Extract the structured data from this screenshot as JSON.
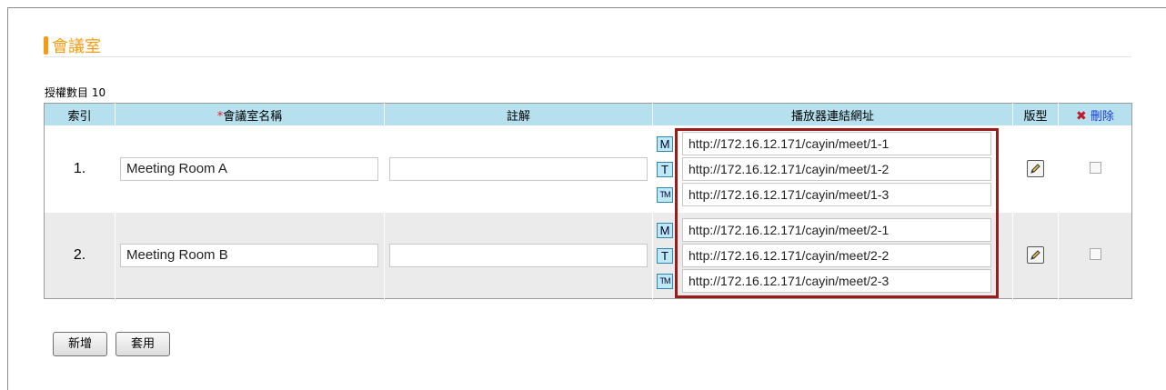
{
  "section": {
    "title": "會議室"
  },
  "license": {
    "label": "授權數目 10"
  },
  "table": {
    "headers": {
      "index": "索引",
      "required_mark": "*",
      "name": "會議室名稱",
      "note": "註解",
      "player_url": "播放器連結網址",
      "layout": "版型",
      "delete_icon": "✖",
      "delete": "刪除"
    },
    "rows": [
      {
        "index": "1.",
        "name": "Meeting Room A",
        "note": "",
        "urls": [
          {
            "badge": "M",
            "url": "http://172.16.12.171/cayin/meet/1-1"
          },
          {
            "badge": "T",
            "url": "http://172.16.12.171/cayin/meet/1-2"
          },
          {
            "badge": "TM",
            "url": "http://172.16.12.171/cayin/meet/1-3"
          }
        ]
      },
      {
        "index": "2.",
        "name": "Meeting Room B",
        "note": "",
        "urls": [
          {
            "badge": "M",
            "url": "http://172.16.12.171/cayin/meet/2-1"
          },
          {
            "badge": "T",
            "url": "http://172.16.12.171/cayin/meet/2-2"
          },
          {
            "badge": "TM",
            "url": "http://172.16.12.171/cayin/meet/2-3"
          }
        ]
      }
    ]
  },
  "buttons": {
    "add": "新增",
    "apply": "套用"
  },
  "colors": {
    "accent": "#f39c12",
    "header_bg": "#b6e0ee",
    "highlight_box": "#9b1b1b",
    "delete_red": "#c0182a",
    "link_blue": "#1a3bd6"
  },
  "icons": {
    "edit": "pencil-icon",
    "delete": "x-icon"
  }
}
